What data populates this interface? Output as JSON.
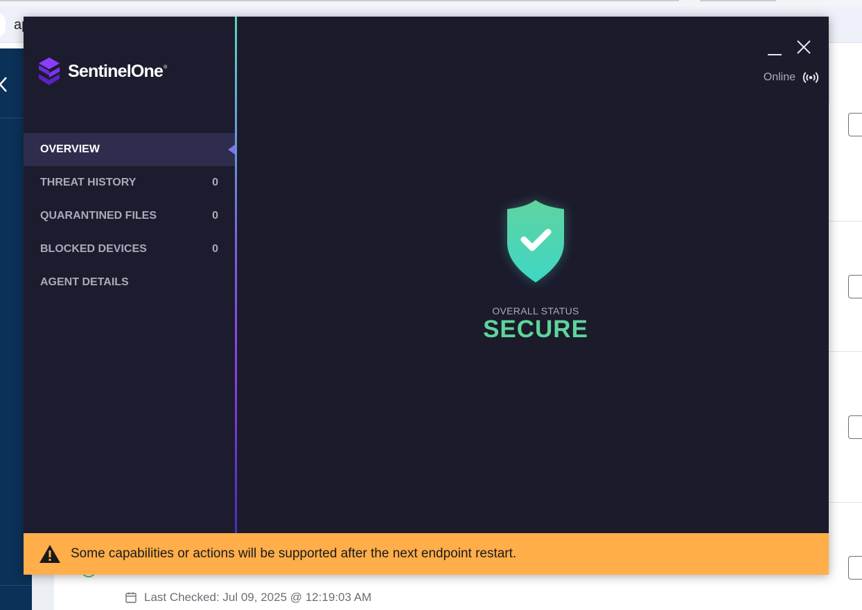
{
  "background": {
    "address_text": "ap",
    "last_checked": "Last Checked: Jul 09, 2025 @ 12:19:03 AM"
  },
  "app": {
    "brand": "SentinelOne",
    "brand_mark": "®",
    "connection_status": "Online"
  },
  "sidebar": {
    "items": [
      {
        "label": "OVERVIEW",
        "count": "",
        "active": true
      },
      {
        "label": "THREAT HISTORY",
        "count": "0"
      },
      {
        "label": "QUARANTINED FILES",
        "count": "0"
      },
      {
        "label": "BLOCKED DEVICES",
        "count": "0"
      },
      {
        "label": "AGENT DETAILS",
        "count": ""
      }
    ]
  },
  "overview": {
    "status_label": "OVERALL STATUS",
    "status_value": "SECURE"
  },
  "banner": {
    "message": "Some capabilities or actions will be supported after the next endpoint restart."
  },
  "colors": {
    "window_bg": "#1c1c2e",
    "active_nav_bg": "#2e2d4d",
    "secure_green": "#5fd49a",
    "banner_orange": "#ffae4a",
    "brand_purple": "#6b2bd9"
  },
  "icons": [
    "sentinelone-logo-icon",
    "minimize-icon",
    "close-icon",
    "online-signal-icon",
    "shield-check-icon",
    "warning-icon",
    "calendar-icon"
  ]
}
